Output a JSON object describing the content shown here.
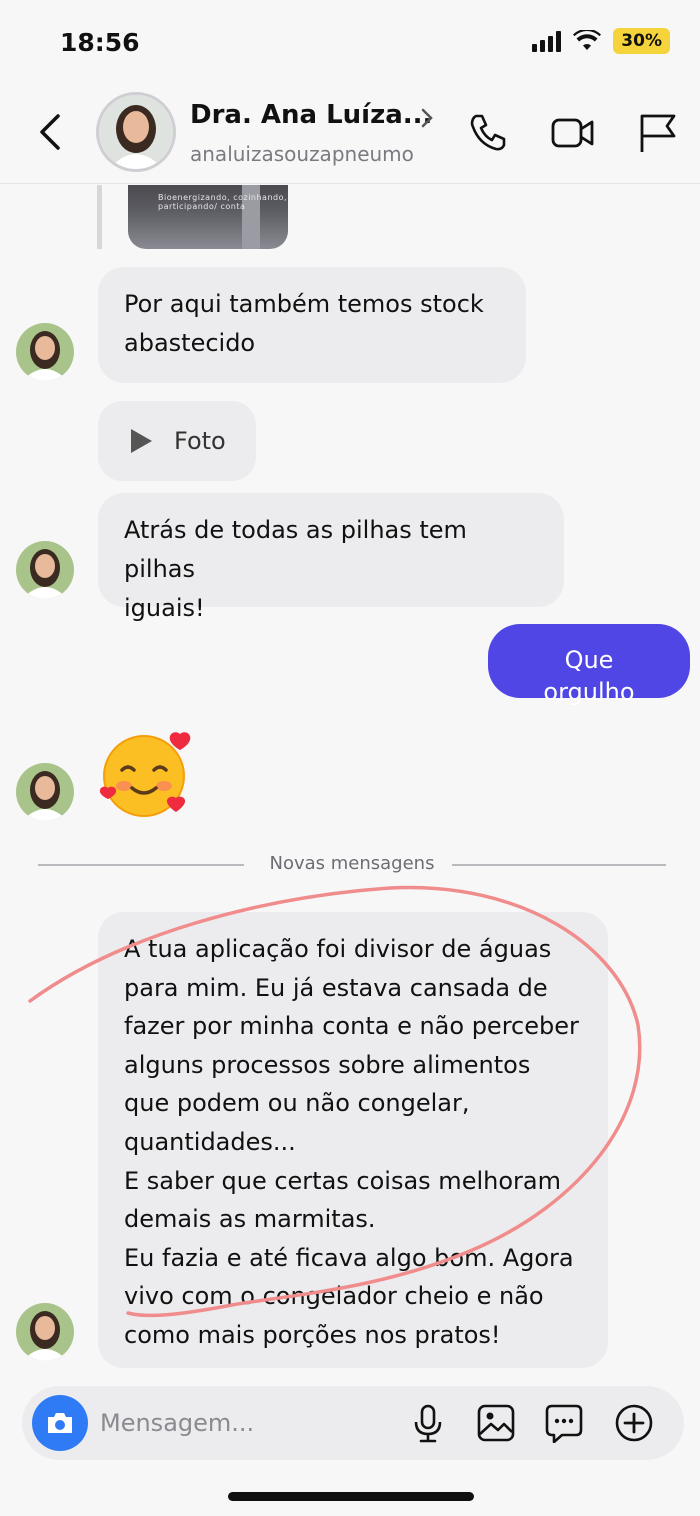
{
  "status_bar": {
    "time": "18:56",
    "battery": "30%"
  },
  "header": {
    "contact_name": "Dra. Ana Luíza...",
    "username": "analuizasouzapneumo",
    "icons": [
      "back-icon",
      "chevron-right-icon",
      "phone-icon",
      "video-icon",
      "flag-icon"
    ]
  },
  "messages": {
    "media_thumb_text": "Bioenergizando, cozinhando, participando/ conta",
    "msg1": [
      "Por aqui também temos stock",
      "abastecido"
    ],
    "foto_label": "Foto",
    "msg2": [
      "Atrás de todas as pilhas tem pilhas",
      "iguais!"
    ],
    "outgoing1": "Que orgulho",
    "emoji_reaction": "smiling-face-with-hearts",
    "divider_label": "Novas mensagens",
    "msg3": [
      "A tua aplicação foi divisor de águas",
      "para mim. Eu já estava cansada de",
      "fazer por minha conta e não perceber",
      "alguns processos sobre alimentos",
      "que podem ou não congelar,",
      "quantidades...",
      "E saber que certas coisas melhoram",
      "demais as marmitas.",
      "Eu fazia e até ficava algo bom. Agora",
      "vivo com o congelador cheio e não",
      "como mais porções nos pratos!"
    ]
  },
  "composer": {
    "placeholder": "Mensagem...",
    "icons": [
      "camera-icon",
      "microphone-icon",
      "image-icon",
      "sticker-icon",
      "plus-icon"
    ]
  },
  "colors": {
    "outgoing_bubble": "#4f46e5",
    "incoming_bubble": "#ececee",
    "camera_button": "#2f7bf6",
    "annotation_stroke": "#f08c8c",
    "battery_badge": "#f5d33a"
  }
}
